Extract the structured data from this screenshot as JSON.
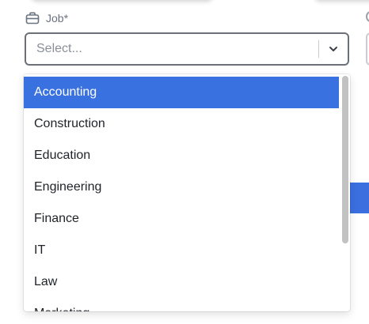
{
  "field": {
    "label": "Job*",
    "icon": "briefcase-icon",
    "placeholder": "Select...",
    "chevron_icon": "chevron-down-icon"
  },
  "dropdown": {
    "options": [
      "Accounting",
      "Construction",
      "Education",
      "Engineering",
      "Finance",
      "IT",
      "Law",
      "Marketing"
    ],
    "highlighted": "Accounting"
  },
  "colors": {
    "accent": "#3a71e0",
    "label": "#6b7280",
    "placeholder": "#8a8f98",
    "border": "#6b7079"
  }
}
